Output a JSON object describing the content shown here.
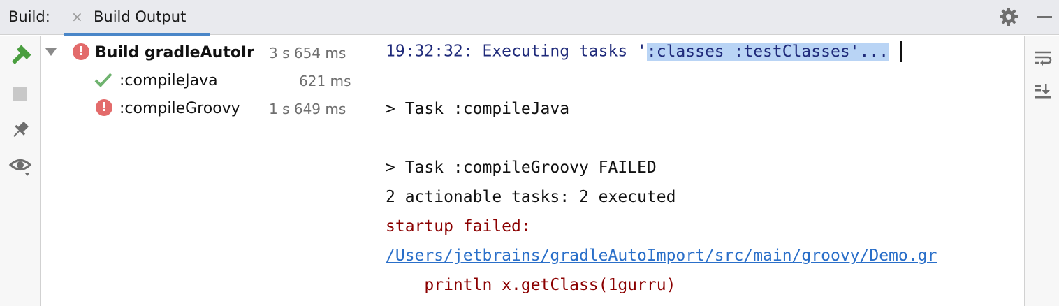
{
  "header": {
    "build_label": "Build:",
    "tab_close_icon": "×",
    "tab_label": "Build Output",
    "icons": [
      "gear-icon",
      "minimize-icon"
    ]
  },
  "left_toolbar": {
    "icons": [
      "rebuild-hammer-icon",
      "stop-icon",
      "pin-icon",
      "eye-icon"
    ]
  },
  "tree": {
    "items": [
      {
        "label": "Build gradleAutoIr",
        "time": "3 s 654 ms",
        "status": "error",
        "bold": true
      },
      {
        "label": ":compileJava",
        "time": "621 ms",
        "status": "success",
        "bold": false
      },
      {
        "label": ":compileGroovy",
        "time": "1 s 649 ms",
        "status": "error",
        "bold": false
      }
    ]
  },
  "console": {
    "line1_prefix": "19:32:32: Executing tasks '",
    "line1_selected": ":classes :testClasses'...",
    "line2": "> Task :compileJava",
    "line3": "> Task :compileGroovy FAILED",
    "line4": "2 actionable tasks: 2 executed",
    "line5": "startup failed:",
    "line6": "/Users/jetbrains/gradleAutoImport/src/main/groovy/Demo.gr",
    "line7": "    println x.getClass(1gurru)"
  },
  "right_toolbar": {
    "icons": [
      "soft-wrap-icon",
      "scroll-to-end-icon"
    ]
  },
  "colors": {
    "accent": "#4a86c8",
    "error": "#e36b6b",
    "success": "#6fb36f",
    "console_blue": "#1f2a7a",
    "console_red": "#8b0000",
    "link": "#2a6fc9",
    "selection": "#b9d4f5"
  }
}
